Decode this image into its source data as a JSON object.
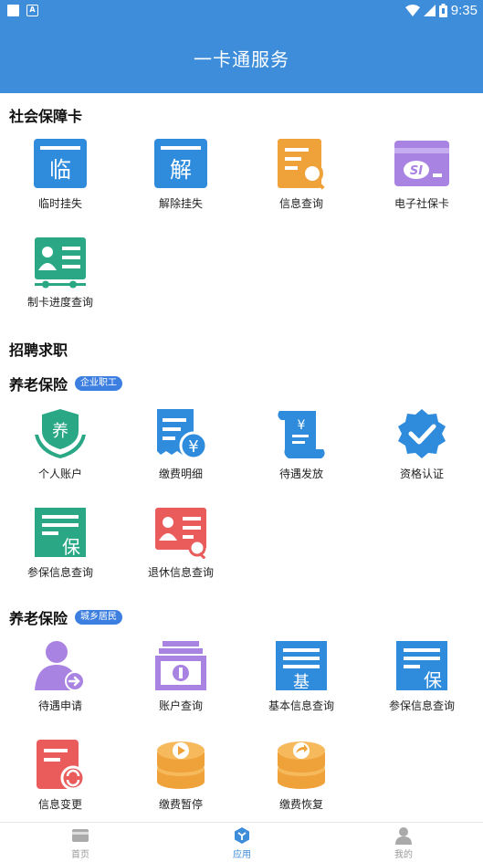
{
  "status_bar": {
    "time": "9:35"
  },
  "header": {
    "title": "一卡通服务"
  },
  "sections": {
    "social_card": {
      "title": "社会保障卡",
      "items": [
        {
          "label": "临时挂失",
          "glyph": "临",
          "icon": "temporary-loss-icon"
        },
        {
          "label": "解除挂失",
          "glyph": "解",
          "icon": "cancel-loss-icon"
        },
        {
          "label": "信息查询",
          "icon": "info-query-icon"
        },
        {
          "label": "电子社保卡",
          "glyph": "SI",
          "icon": "e-social-card-icon"
        },
        {
          "label": "制卡进度查询",
          "icon": "card-progress-icon"
        }
      ]
    },
    "recruitment": {
      "title": "招聘求职"
    },
    "pension_enterprise": {
      "title": "养老保险",
      "tag": "企业职工",
      "items": [
        {
          "label": "个人账户",
          "glyph": "养",
          "icon": "personal-account-icon"
        },
        {
          "label": "缴费明细",
          "glyph": "¥",
          "icon": "payment-detail-icon"
        },
        {
          "label": "待遇发放",
          "glyph": "¥",
          "icon": "benefit-payment-icon"
        },
        {
          "label": "资格认证",
          "icon": "qualification-icon"
        },
        {
          "label": "参保信息查询",
          "glyph": "保",
          "icon": "insured-info-icon"
        },
        {
          "label": "退休信息查询",
          "icon": "retirement-info-icon"
        }
      ]
    },
    "pension_resident": {
      "title": "养老保险",
      "tag": "城乡居民",
      "items": [
        {
          "label": "待遇申请",
          "icon": "benefit-apply-icon"
        },
        {
          "label": "账户查询",
          "icon": "account-query-icon"
        },
        {
          "label": "基本信息查询",
          "glyph": "基",
          "icon": "basic-info-icon"
        },
        {
          "label": "参保信息查询",
          "glyph": "保",
          "icon": "insured-info-icon"
        },
        {
          "label": "信息变更",
          "icon": "info-change-icon"
        },
        {
          "label": "缴费暂停",
          "icon": "payment-pause-icon"
        },
        {
          "label": "缴费恢复",
          "icon": "payment-resume-icon"
        }
      ]
    }
  },
  "tabbar": {
    "items": [
      {
        "label": "首页",
        "icon": "home-icon"
      },
      {
        "label": "应用",
        "icon": "apps-icon",
        "active": true
      },
      {
        "label": "我的",
        "icon": "profile-icon"
      }
    ]
  },
  "colors": {
    "primary": "#3d8ddb",
    "blue": "#2f8bdc",
    "orange": "#f0a23a",
    "purple": "#a983e2",
    "green": "#2aa886",
    "red": "#ea5b5b"
  }
}
